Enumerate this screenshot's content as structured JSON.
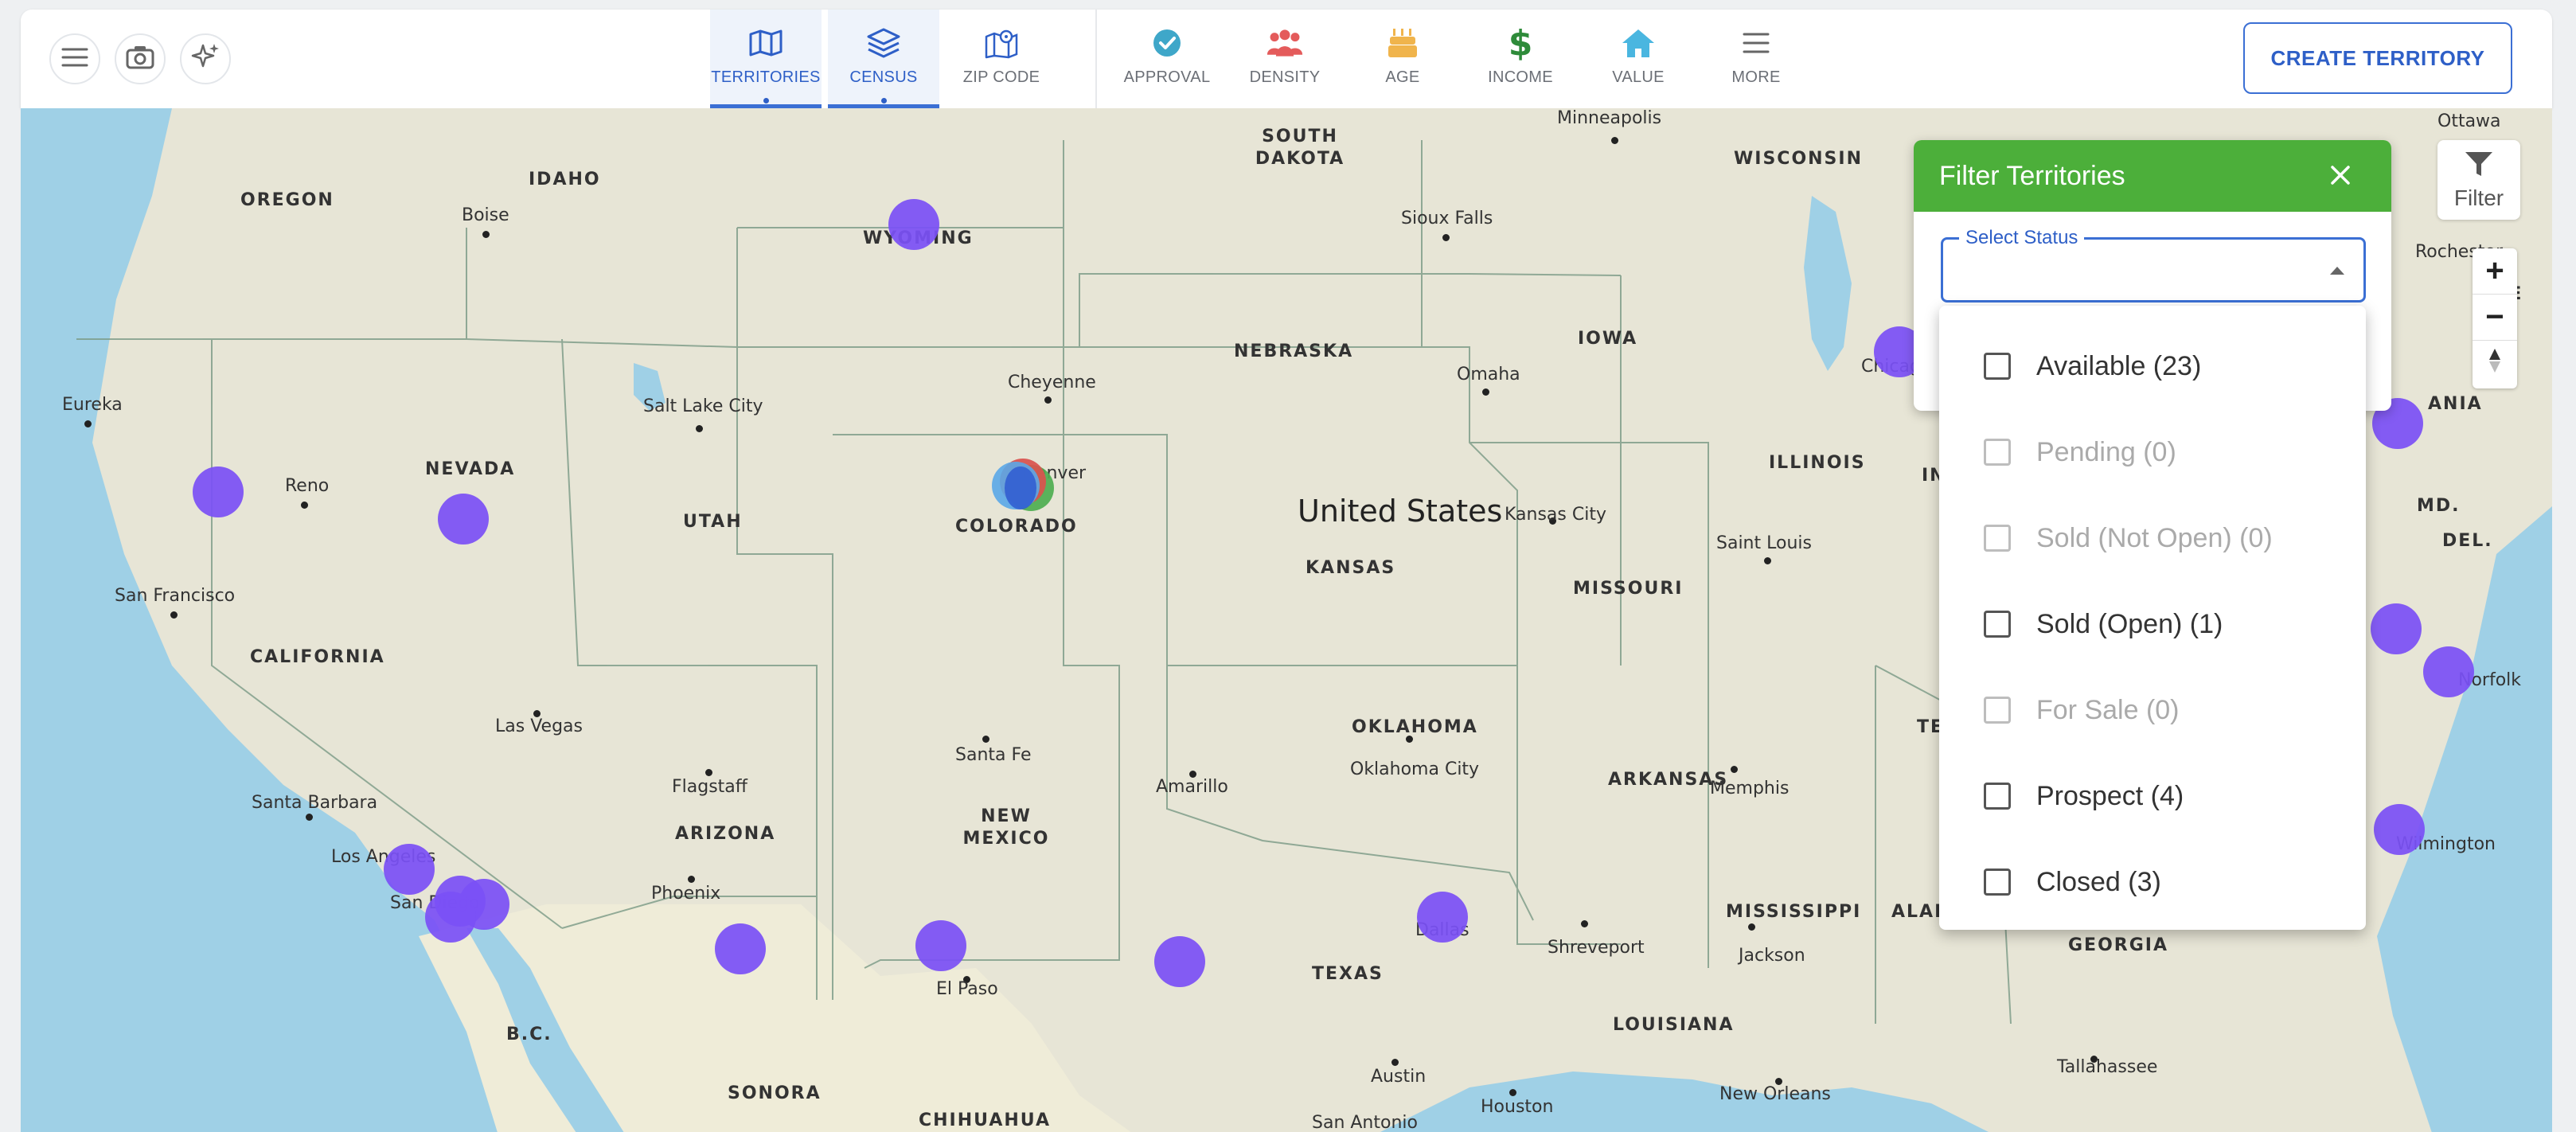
{
  "toolbar": {
    "nav": [
      {
        "label": "TERRITORIES",
        "icon": "map-icon",
        "active": true
      },
      {
        "label": "CENSUS",
        "icon": "layers-icon",
        "active": true
      },
      {
        "label": "ZIP CODE",
        "icon": "map-pin-icon",
        "active": false
      },
      {
        "label": "APPROVAL",
        "icon": "check-circle-icon",
        "active": false
      },
      {
        "label": "DENSITY",
        "icon": "people-icon",
        "active": false
      },
      {
        "label": "AGE",
        "icon": "cake-icon",
        "active": false
      },
      {
        "label": "INCOME",
        "icon": "dollar-icon",
        "active": false
      },
      {
        "label": "VALUE",
        "icon": "home-icon",
        "active": false
      },
      {
        "label": "MORE",
        "icon": "menu-lines-icon",
        "active": false
      }
    ],
    "create_button": "CREATE TERRITORY"
  },
  "map": {
    "country_label": "United States",
    "states": [
      {
        "label": "OREGON"
      },
      {
        "label": "IDAHO"
      },
      {
        "label": "WYOMING"
      },
      {
        "label": "SOUTH DAKOTA"
      },
      {
        "label": "WISCONSIN"
      },
      {
        "label": "NEBRASKA"
      },
      {
        "label": "IOWA"
      },
      {
        "label": "NEVADA"
      },
      {
        "label": "UTAH"
      },
      {
        "label": "COLORADO"
      },
      {
        "label": "KANSAS"
      },
      {
        "label": "ILLINOIS"
      },
      {
        "label": "MISSOURI"
      },
      {
        "label": "CALIFORNIA"
      },
      {
        "label": "OKLAHOMA"
      },
      {
        "label": "ARKANSAS"
      },
      {
        "label": "ARIZONA"
      },
      {
        "label": "NEW MEXICO"
      },
      {
        "label": "TEXAS"
      },
      {
        "label": "MISSISSIPPI"
      },
      {
        "label": "ALABAMA"
      },
      {
        "label": "GEORGIA"
      },
      {
        "label": "LOUISIANA"
      },
      {
        "label": "B.C."
      },
      {
        "label": "SONORA"
      },
      {
        "label": "CHIHUAHUA"
      },
      {
        "label": "TE"
      },
      {
        "label": "IN"
      },
      {
        "label": "MD."
      },
      {
        "label": "DEL."
      },
      {
        "label": "NE"
      },
      {
        "label": "ANIA"
      }
    ],
    "cities": [
      {
        "label": "Minneapolis"
      },
      {
        "label": "Ottawa"
      },
      {
        "label": "Boise"
      },
      {
        "label": "Sioux Falls"
      },
      {
        "label": "Eureka"
      },
      {
        "label": "Salt Lake City"
      },
      {
        "label": "Cheyenne"
      },
      {
        "label": "Omaha"
      },
      {
        "label": "Reno"
      },
      {
        "label": "Denver"
      },
      {
        "label": "Kansas City"
      },
      {
        "label": "Saint Louis"
      },
      {
        "label": "San Francisco"
      },
      {
        "label": "Las Vegas"
      },
      {
        "label": "Oklahoma City"
      },
      {
        "label": "Santa Fe"
      },
      {
        "label": "Flagstaff"
      },
      {
        "label": "Amarillo"
      },
      {
        "label": "Memphis"
      },
      {
        "label": "Santa Barbara"
      },
      {
        "label": "Los Angeles"
      },
      {
        "label": "San Diego"
      },
      {
        "label": "Phoenix"
      },
      {
        "label": "El Paso"
      },
      {
        "label": "Dallas"
      },
      {
        "label": "Shreveport"
      },
      {
        "label": "Jackson"
      },
      {
        "label": "Austin"
      },
      {
        "label": "Houston"
      },
      {
        "label": "San Antonio"
      },
      {
        "label": "New Orleans"
      },
      {
        "label": "Tallahassee"
      },
      {
        "label": "Chicago"
      },
      {
        "label": "Rochester"
      },
      {
        "label": "Norfolk"
      },
      {
        "label": "Wilmington"
      }
    ]
  },
  "filter_control": {
    "label": "Filter",
    "icon": "funnel-icon"
  },
  "zoom": {
    "in": "+",
    "out": "−"
  },
  "filter_panel": {
    "title": "Filter Territories",
    "status_label": "Select Status",
    "options": [
      {
        "label": "Available (23)",
        "disabled": false
      },
      {
        "label": "Pending (0)",
        "disabled": true
      },
      {
        "label": "Sold (Not Open) (0)",
        "disabled": true
      },
      {
        "label": "Sold (Open) (1)",
        "disabled": false
      },
      {
        "label": "For Sale (0)",
        "disabled": true
      },
      {
        "label": "Prospect (4)",
        "disabled": false
      },
      {
        "label": "Closed (3)",
        "disabled": false
      }
    ]
  },
  "colors": {
    "accent": "#3b6fd4",
    "panel_header": "#4caf3a",
    "marker": "#7b51f5",
    "water": "#9fd0e6",
    "land": "#e8e6d8"
  }
}
